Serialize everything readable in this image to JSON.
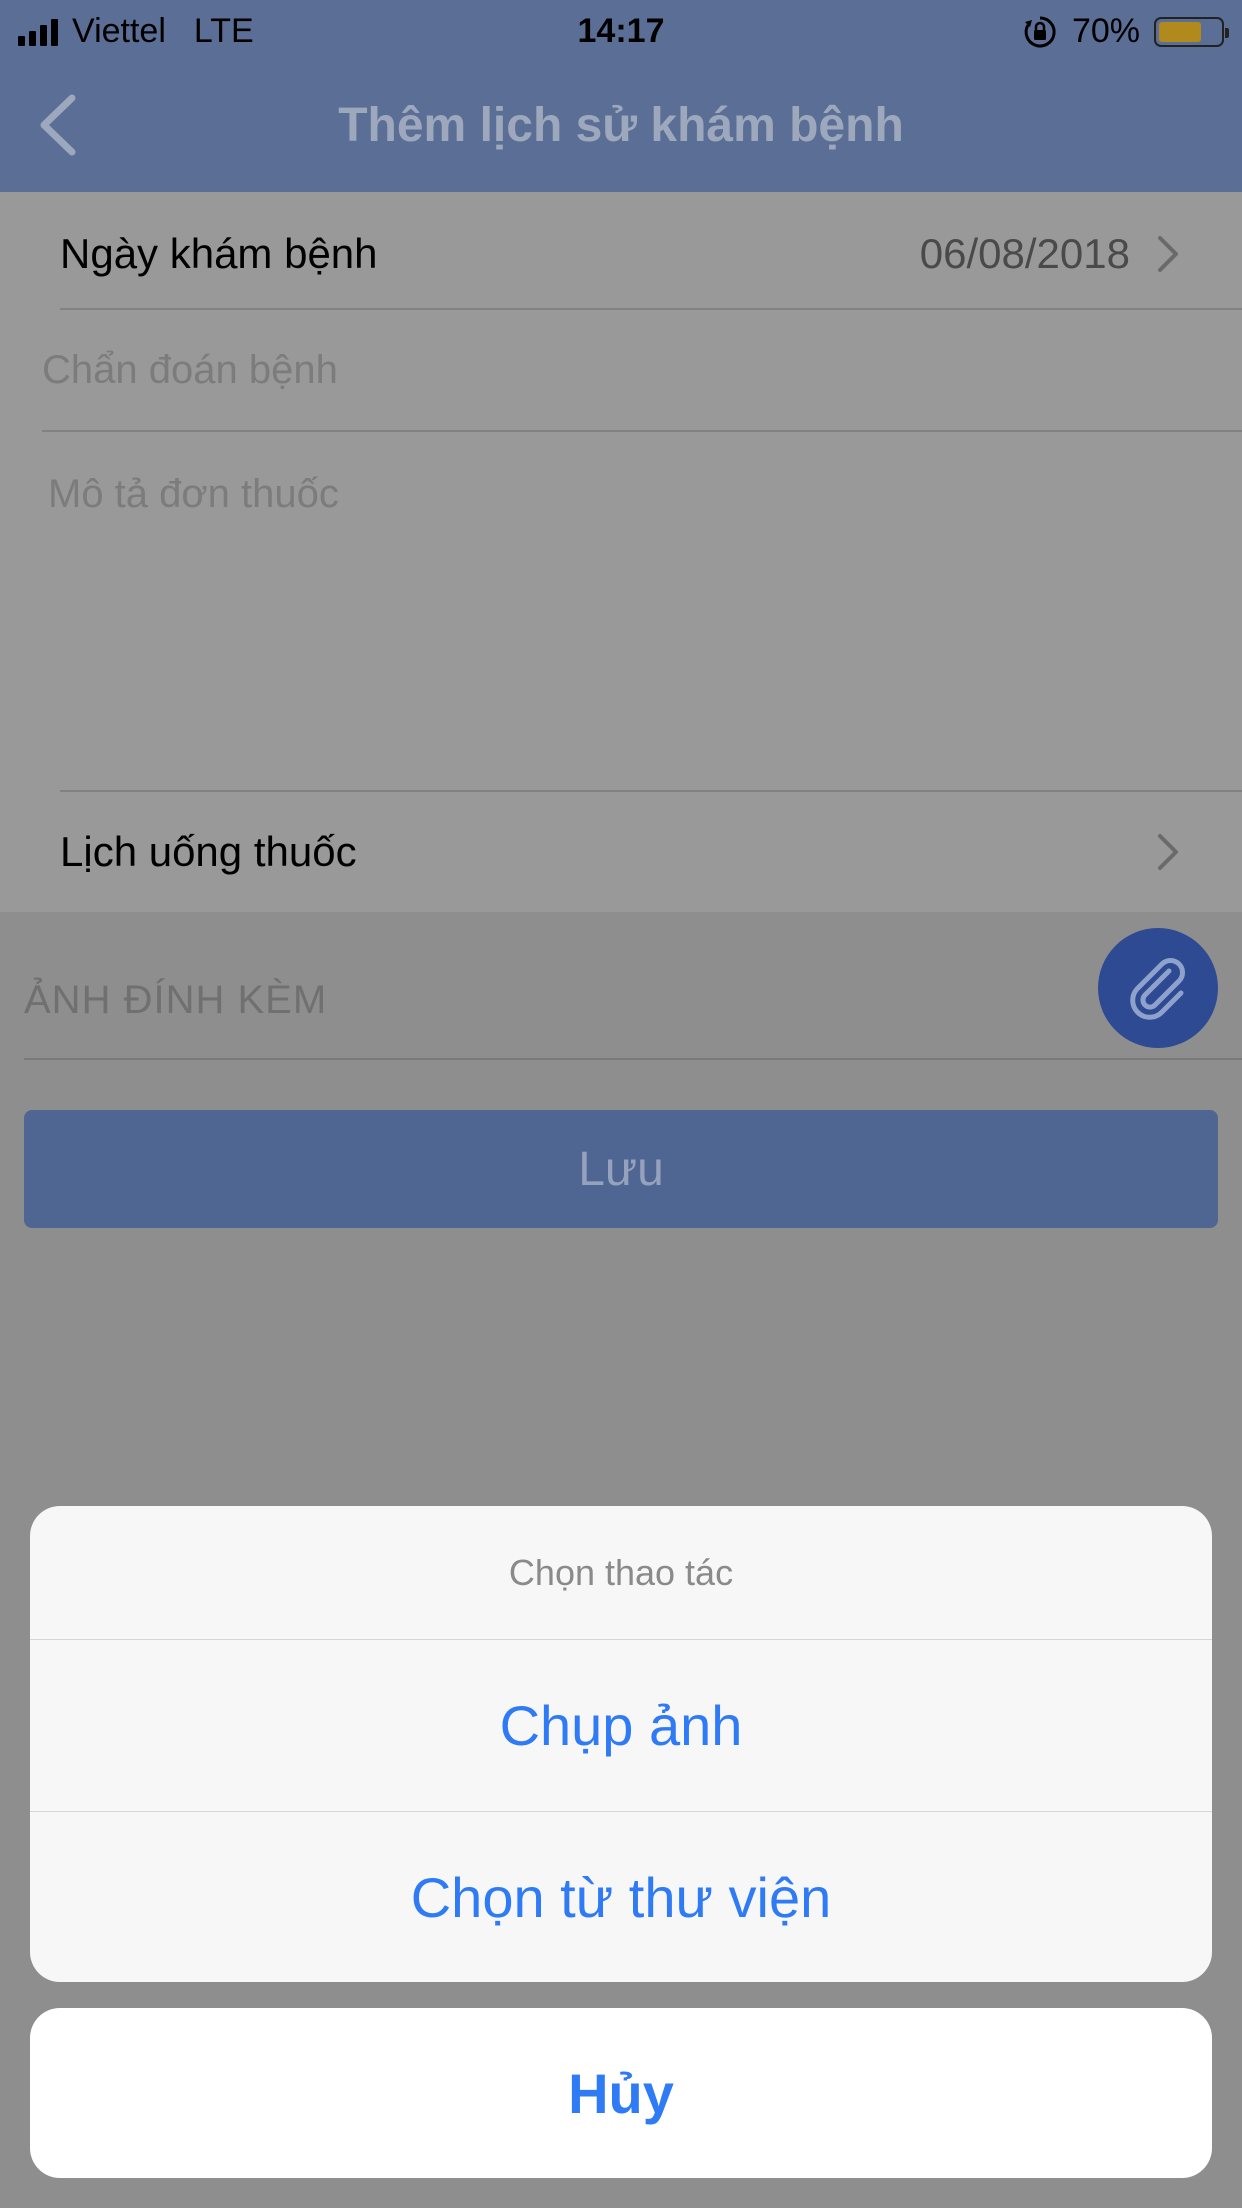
{
  "status_bar": {
    "carrier": "Viettel",
    "network": "LTE",
    "time": "14:17",
    "battery": "70%",
    "battery_level": 0.7
  },
  "nav": {
    "title": "Thêm lịch sử khám bệnh",
    "back_icon": "chevron-left-icon"
  },
  "form": {
    "exam_date_label": "Ngày khám bệnh",
    "exam_date_value": "06/08/2018",
    "diagnosis_placeholder": "Chẩn đoán bệnh",
    "prescription_placeholder": "Mô tả đơn thuốc",
    "medication_schedule_label": "Lịch uống thuốc"
  },
  "attachment": {
    "label": "ẢNH ĐÍNH KÈM",
    "icon": "paperclip-icon"
  },
  "save_label": "Lưu",
  "action_sheet": {
    "title": "Chọn thao tác",
    "options": [
      "Chụp ảnh",
      "Chọn từ thư viện"
    ],
    "cancel": "Hủy"
  },
  "colors": {
    "nav_bg": "#5b6e96",
    "action_blue": "#2f7af5",
    "attach_button": "#2e4a92"
  }
}
